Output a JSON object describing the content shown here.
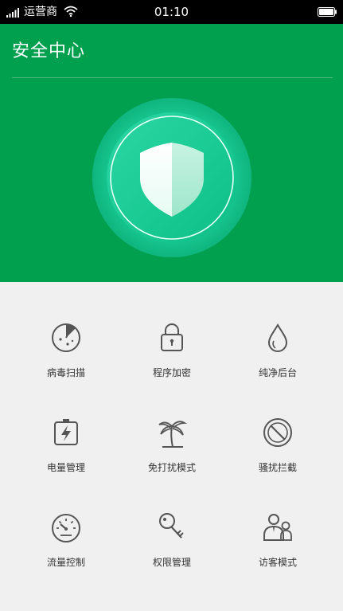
{
  "status_bar": {
    "carrier": "运营商",
    "time": "01:10"
  },
  "header": {
    "title": "安全中心"
  },
  "colors": {
    "hero_green": "#00a04f",
    "icon_gray": "#555555"
  },
  "tiles": [
    {
      "label": "病毒扫描",
      "icon": "virus-scan-icon"
    },
    {
      "label": "程序加密",
      "icon": "lock-icon"
    },
    {
      "label": "纯净后台",
      "icon": "water-drop-icon"
    },
    {
      "label": "电量管理",
      "icon": "battery-charge-icon"
    },
    {
      "label": "免打扰模式",
      "icon": "palm-tree-icon"
    },
    {
      "label": "骚扰拦截",
      "icon": "block-icon"
    },
    {
      "label": "流量控制",
      "icon": "speedometer-icon"
    },
    {
      "label": "权限管理",
      "icon": "key-icon"
    },
    {
      "label": "访客模式",
      "icon": "guest-users-icon"
    }
  ]
}
